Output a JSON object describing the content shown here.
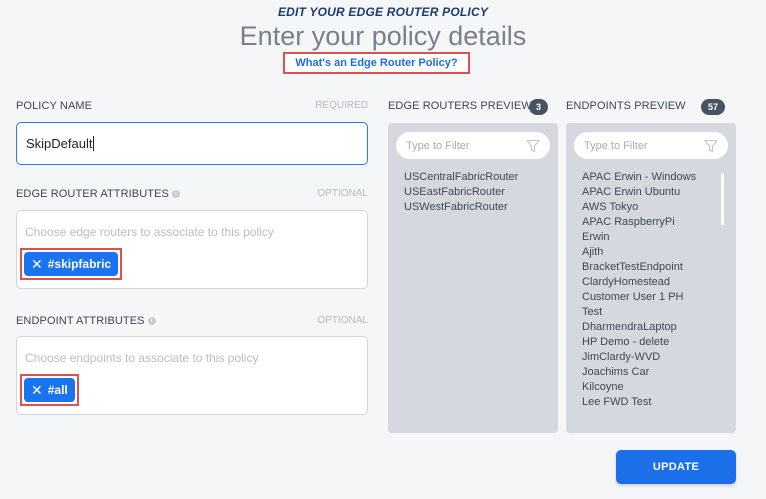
{
  "header": {
    "overline": "EDIT YOUR EDGE ROUTER POLICY",
    "title": "Enter your policy details",
    "help_link": "What's an Edge Router Policy?"
  },
  "policy_name": {
    "label": "POLICY NAME",
    "hint": "REQUIRED",
    "value": "SkipDefault"
  },
  "edge_router_attributes": {
    "label": "EDGE ROUTER ATTRIBUTES",
    "hint": "OPTIONAL",
    "placeholder": "Choose edge routers to associate to this policy",
    "tags": [
      "#skipfabric"
    ]
  },
  "endpoint_attributes": {
    "label": "ENDPOINT ATTRIBUTES",
    "hint": "OPTIONAL",
    "placeholder": "Choose endpoints to associate to this policy",
    "tags": [
      "#all"
    ]
  },
  "edge_routers_preview": {
    "label": "EDGE ROUTERS PREVIEW",
    "count": "3",
    "filter_placeholder": "Type to Filter",
    "items": [
      "USCentralFabricRouter",
      "USEastFabricRouter",
      "USWestFabricRouter"
    ]
  },
  "endpoints_preview": {
    "label": "ENDPOINTS PREVIEW",
    "count": "57",
    "filter_placeholder": "Type to Filter",
    "items": [
      "APAC Erwin - Windows",
      "APAC Erwin Ubuntu",
      "AWS Tokyo",
      "APAC RaspberryPi",
      "Erwin",
      "Ajith",
      "BracketTestEndpoint",
      "ClardyHomestead",
      "Customer User 1 PH",
      "Test",
      "DharmendraLaptop",
      "HP Demo - delete",
      "JimClardy-WVD",
      "Joachims Car",
      "Kilcoyne",
      "Lee FWD Test"
    ]
  },
  "actions": {
    "update": "UPDATE"
  },
  "colors": {
    "accent": "#1b6fe8",
    "highlight_outline": "#e0504f",
    "header_navy": "#1e3b6d"
  }
}
